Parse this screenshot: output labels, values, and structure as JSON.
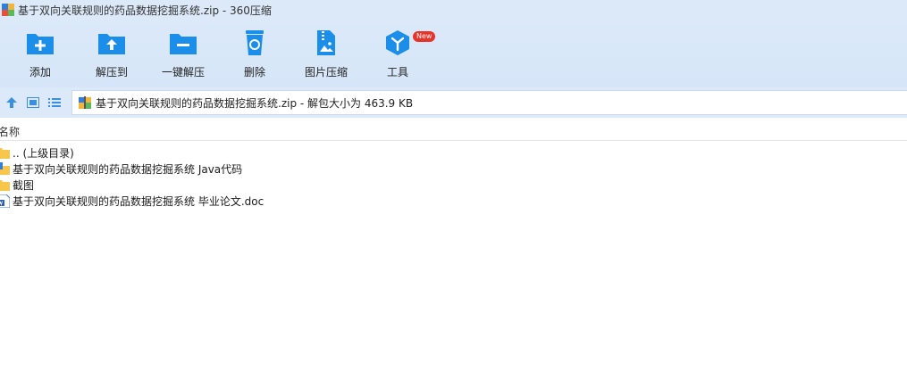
{
  "window": {
    "title": "基于双向关联规则的药品数据挖掘系统.zip - 360压缩"
  },
  "toolbar": {
    "items": [
      {
        "label": "添加",
        "icon": "add-folder-icon"
      },
      {
        "label": "解压到",
        "icon": "extract-to-icon"
      },
      {
        "label": "一键解压",
        "icon": "one-click-extract-icon"
      },
      {
        "label": "删除",
        "icon": "recycle-bin-icon"
      },
      {
        "label": "图片压缩",
        "icon": "image-compress-icon"
      },
      {
        "label": "工具",
        "icon": "tools-icon",
        "badge": "New"
      }
    ]
  },
  "address": {
    "text": "基于双向关联规则的药品数据挖掘系统.zip - 解包大小为 463.9 KB"
  },
  "list": {
    "header": "名称",
    "rows": [
      {
        "name": ".. (上级目录)",
        "type": "folder"
      },
      {
        "name": "基于双向关联规则的药品数据挖掘系统 Java代码",
        "type": "zip-folder"
      },
      {
        "name": "截图",
        "type": "folder"
      },
      {
        "name": "基于双向关联规则的药品数据挖掘系统 毕业论文.doc",
        "type": "doc"
      }
    ]
  },
  "colors": {
    "accent": "#1a8ee8",
    "chrome": "#dbe9f9",
    "badge": "#e8332b",
    "folder": "#f8c64a"
  }
}
